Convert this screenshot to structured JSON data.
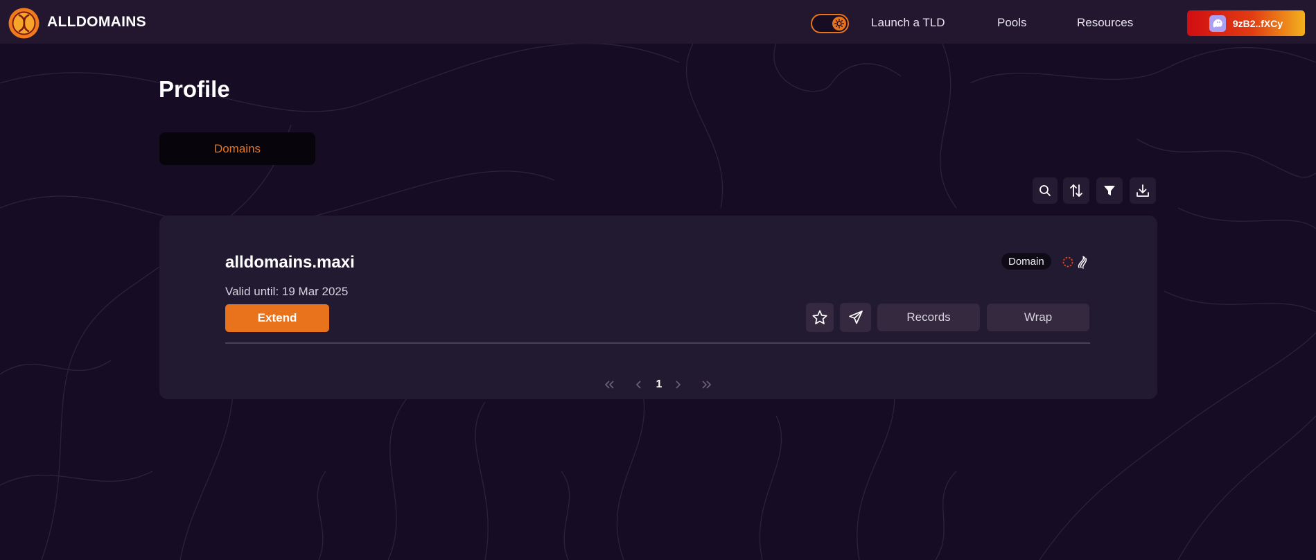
{
  "header": {
    "brand": "ALLDOMAINS",
    "nav": [
      {
        "label": "Launch a TLD"
      },
      {
        "label": "Pools"
      },
      {
        "label": "Resources"
      }
    ],
    "wallet_label": "9zB2..fXCy"
  },
  "main": {
    "title": "Profile",
    "tabs": [
      {
        "label": "Domains"
      }
    ],
    "domains": [
      {
        "name": "alldomains.maxi",
        "valid_until": "Valid until: 19 Mar 2025",
        "badge": "Domain",
        "actions": {
          "extend": "Extend",
          "records": "Records",
          "wrap": "Wrap"
        }
      }
    ],
    "pagination": {
      "current_page": "1"
    }
  },
  "colors": {
    "background": "#160c24",
    "header": "#22172f",
    "accent": "#e8731c",
    "card": "#221a30"
  },
  "icons": [
    "alldomains-logo",
    "sun-icon",
    "phantom-wallet-icon",
    "search-icon",
    "sort-icon",
    "filter-icon",
    "download-icon",
    "star-icon",
    "send-icon",
    "loading-spinner-icon",
    "solana-icon",
    "double-chevron-left-icon",
    "chevron-left-icon",
    "chevron-right-icon",
    "double-chevron-right-icon"
  ]
}
